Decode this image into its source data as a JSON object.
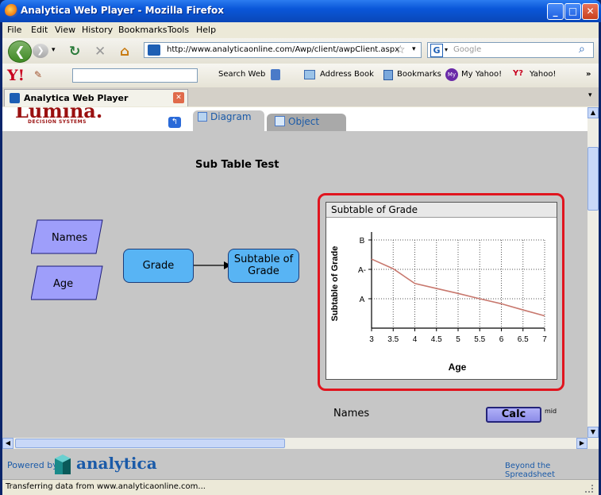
{
  "window": {
    "title": "Analytica Web Player - Mozilla Firefox",
    "minimize": "_",
    "maximize": "□",
    "close": "✕"
  },
  "menu": [
    "File",
    "Edit",
    "View",
    "History",
    "Bookmarks",
    "Tools",
    "Help"
  ],
  "nav": {
    "url": "http://www.analyticaonline.com/Awp/client/awpClient.aspx",
    "search_placeholder": "Google",
    "search_engine_letter": "G"
  },
  "toolbar": {
    "search_web": "Search Web",
    "address_book": "Address Book",
    "bookmarks": "Bookmarks",
    "my_yahoo": "My Yahoo!",
    "yahoo": "Yahoo!",
    "overflow": "»"
  },
  "browser_tab": {
    "label": "Analytica Web Player"
  },
  "app": {
    "logo_main": "Lumina.",
    "logo_sub": "DECISION SYSTEMS",
    "tabs": [
      "Diagram",
      "Object"
    ],
    "diagram_title": "Sub Table Test",
    "nodes": {
      "names": "Names",
      "age": "Age",
      "grade": "Grade",
      "subtable_line1": "Subtable of",
      "subtable_line2": "Grade"
    },
    "bottom_names": "Names",
    "calc": "Calc",
    "calc_note": "mid"
  },
  "chart_data": {
    "type": "line",
    "title": "Subtable of Grade",
    "xlabel": "Age",
    "ylabel": "Subtable of Grade",
    "x_ticks": [
      "3",
      "3.5",
      "4",
      "4.5",
      "5",
      "5.5",
      "6",
      "6.5",
      "7"
    ],
    "y_ticks": [
      "A",
      "A-",
      "B"
    ],
    "x": [
      3,
      3.5,
      4,
      4.5,
      5,
      5.5,
      6,
      6.5,
      7
    ],
    "values": [
      2.35,
      2.02,
      1.52,
      1.35,
      1.18,
      1.0,
      0.83,
      0.62,
      0.42
    ],
    "y_note": "A=1, A-=2, B=3 positions on categorical axis",
    "line_color": "#c8786e",
    "grid": true
  },
  "footer": {
    "powered_by": "Powered by",
    "brand": "analytica",
    "tagline": "Beyond the Spreadsheet"
  },
  "status": {
    "text": "Transferring data from www.analyticaonline.com..."
  }
}
